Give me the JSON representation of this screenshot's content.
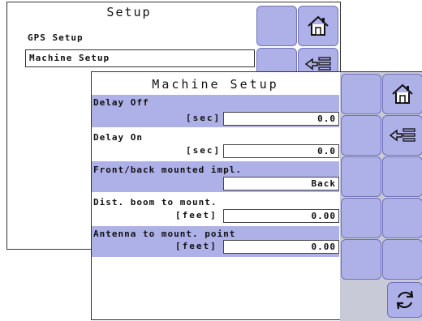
{
  "background": {
    "title": "Setup",
    "items": [
      {
        "label": "GPS Setup",
        "selected": false
      },
      {
        "label": "Machine Setup",
        "selected": true
      }
    ]
  },
  "dialog": {
    "title": "Machine Setup",
    "rows": [
      {
        "label": "Delay Off",
        "unit": "[sec]",
        "value": "0.0",
        "highlighted": true
      },
      {
        "label": "Delay On",
        "unit": "[sec]",
        "value": "0.0",
        "highlighted": false
      },
      {
        "label": "Front/back mounted impl.",
        "unit": "",
        "value": "Back",
        "highlighted": true
      },
      {
        "label": "Dist. boom to mount.",
        "unit": "[feet]",
        "value": "0.00",
        "highlighted": false
      },
      {
        "label": "Antenna to mount. point",
        "unit": "[feet]",
        "value": "0.00",
        "highlighted": true
      }
    ]
  },
  "icons": {
    "home": "home-icon",
    "back": "back-arrow-list-icon",
    "refresh": "refresh-icon"
  },
  "colors": {
    "button_fill": "#aeb0e8",
    "highlight_band": "#aeb0e8",
    "panel_bg": "#ffffff"
  }
}
